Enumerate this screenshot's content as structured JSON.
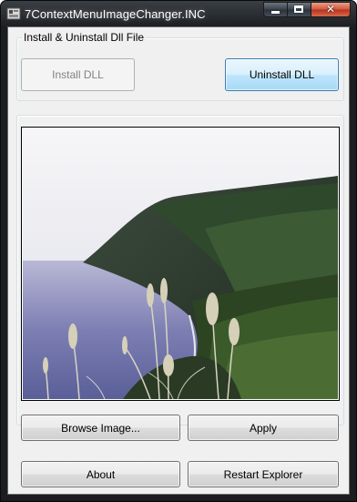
{
  "window": {
    "title": "7ContextMenuImageChanger.INC",
    "icon": "app-window-icon",
    "caption_buttons": [
      "minimize-icon",
      "maximize-icon",
      "close-icon"
    ]
  },
  "install_group": {
    "legend": "Install & Uninstall Dll File",
    "install_button": {
      "label": "Install DLL",
      "enabled": false
    },
    "uninstall_button": {
      "label": "Uninstall DLL",
      "focused": true
    }
  },
  "preview": {
    "image": "coastal-cliff-landscape-photo"
  },
  "actions": {
    "browse_label": "Browse Image...",
    "apply_label": "Apply",
    "about_label": "About",
    "restart_label": "Restart Explorer"
  },
  "colors": {
    "titlebar": "#1b1d20",
    "client_background": "#f0f0f0",
    "focused_button": "#bee6fd",
    "close_button": "#c8452a"
  }
}
